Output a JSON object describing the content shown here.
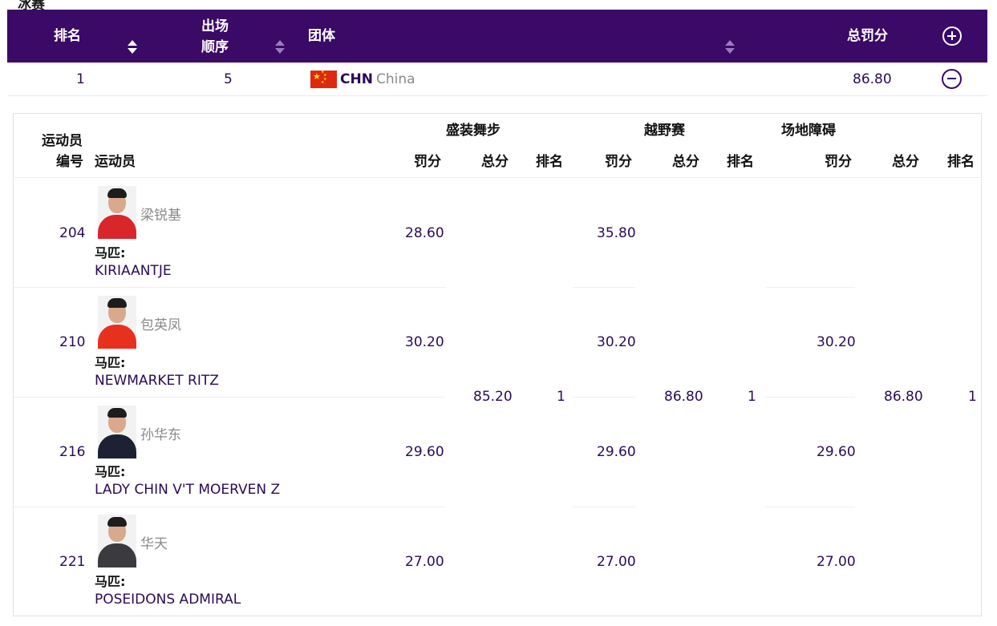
{
  "page": {
    "top_cut_title": "冰赛"
  },
  "colors": {
    "header_bg": "#3a0a66",
    "text": "#2b0a55",
    "muted": "#8a8a8a",
    "flag_red": "#de2910",
    "flag_star": "#ffde00"
  },
  "header": {
    "rank": "排名",
    "order_line1": "出场",
    "order_line2": "顺序",
    "team": "团体",
    "total_penalty": "总罚分",
    "expand_all_icon": "plus-circle-icon"
  },
  "team": {
    "rank": "1",
    "order": "5",
    "code": "CHN",
    "country": "China",
    "total": "86.80",
    "flag_icon": "flag-cn-icon",
    "collapse_icon": "minus-circle-icon"
  },
  "detail": {
    "athlete_no_line1": "运动员",
    "athlete_no_line2": "编号",
    "athlete": "运动员",
    "phases": [
      "盛装舞步",
      "越野赛",
      "场地障碍"
    ],
    "sub_penalty": "罚分",
    "sub_total": "总分",
    "sub_rank": "排名",
    "horse_label": "马匹:",
    "riders": [
      {
        "no": "204",
        "name": "梁锐基",
        "horse": "KIRIAANTJE",
        "dressage": "28.60",
        "cross": "35.80",
        "jumping": ""
      },
      {
        "no": "210",
        "name": "包英凤",
        "horse": "NEWMARKET RITZ",
        "dressage": "30.20",
        "cross": "30.20",
        "jumping": "30.20"
      },
      {
        "no": "216",
        "name": "孙华东",
        "horse": "LADY CHIN V'T MOERVEN Z",
        "dressage": "29.60",
        "cross": "29.60",
        "jumping": "29.60"
      },
      {
        "no": "221",
        "name": "华天",
        "horse": "POSEIDONS ADMIRAL",
        "dressage": "27.00",
        "cross": "27.00",
        "jumping": "27.00"
      }
    ],
    "phase_totals": [
      {
        "total": "85.20",
        "rank": "1"
      },
      {
        "total": "86.80",
        "rank": "1"
      },
      {
        "total": "86.80",
        "rank": "1"
      }
    ]
  }
}
